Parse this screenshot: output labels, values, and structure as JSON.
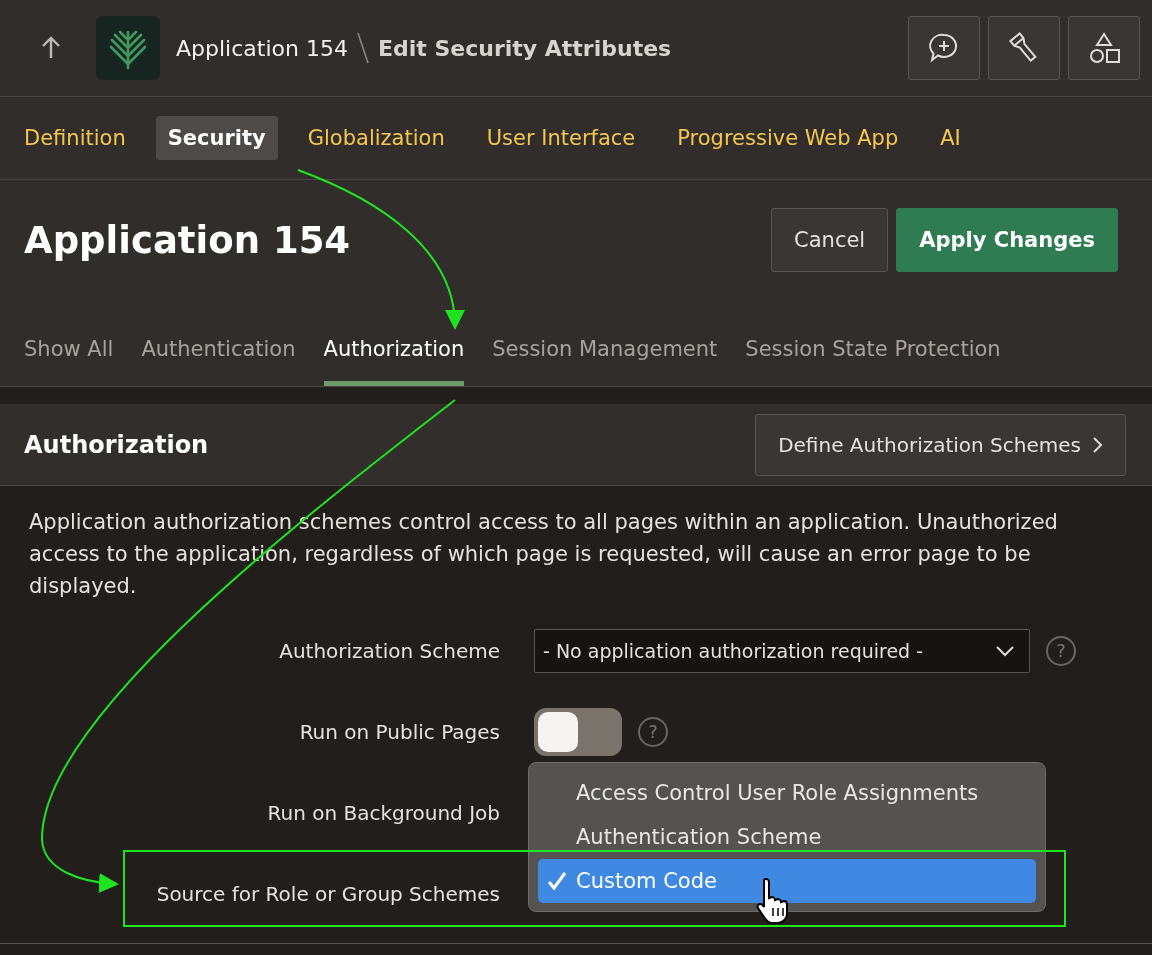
{
  "header": {
    "app_name": "Application 154",
    "page_title": "Edit Security Attributes"
  },
  "nav_tabs": [
    {
      "label": "Definition",
      "selected": false
    },
    {
      "label": "Security",
      "selected": true
    },
    {
      "label": "Globalization",
      "selected": false
    },
    {
      "label": "User Interface",
      "selected": false
    },
    {
      "label": "Progressive Web App",
      "selected": false
    },
    {
      "label": "AI",
      "selected": false
    }
  ],
  "page": {
    "title": "Application 154",
    "buttons": [
      {
        "label": "Cancel",
        "kind": "secondary"
      },
      {
        "label": "Apply Changes",
        "kind": "primary"
      }
    ]
  },
  "subtabs": [
    {
      "label": "Show All",
      "selected": false
    },
    {
      "label": "Authentication",
      "selected": false
    },
    {
      "label": "Authorization",
      "selected": true
    },
    {
      "label": "Session Management",
      "selected": false
    },
    {
      "label": "Session State Protection",
      "selected": false
    }
  ],
  "region": {
    "title": "Authorization",
    "button": "Define Authorization Schemes",
    "description": "Application authorization schemes control access to all pages within an application. Unauthorized access to the application, regardless of which page is requested, will cause an error page to be displayed."
  },
  "fields": [
    {
      "label": "Authorization Scheme",
      "kind": "select",
      "value": "- No application authorization required -",
      "help": "?"
    },
    {
      "label": "Run on Public Pages",
      "kind": "switch",
      "on": false,
      "help": "?"
    },
    {
      "label": "Run on Background Job",
      "kind": "covered"
    },
    {
      "label": "Source for Role or Group Schemes",
      "kind": "covered"
    }
  ],
  "dropdown": {
    "options": [
      {
        "label": "Access Control User Role Assignments",
        "selected": false
      },
      {
        "label": "Authentication Scheme",
        "selected": false
      },
      {
        "label": "Custom Code",
        "selected": true
      }
    ]
  }
}
